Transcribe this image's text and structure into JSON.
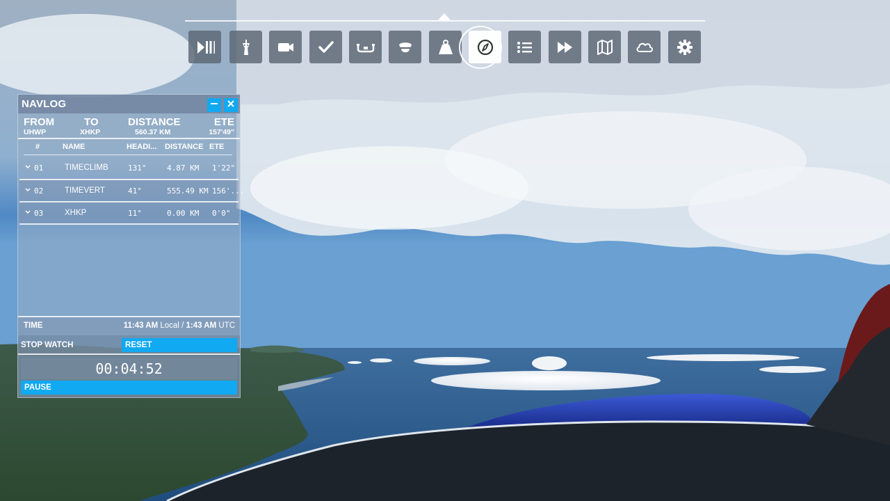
{
  "toolbar": {
    "buttons": [
      {
        "id": "pause-play",
        "icon": "play-pause-icon"
      },
      {
        "id": "atc",
        "icon": "control-tower-icon"
      },
      {
        "id": "camera",
        "icon": "camera-icon"
      },
      {
        "id": "checklist",
        "icon": "checkmark-icon"
      },
      {
        "id": "controls",
        "icon": "yoke-icon"
      },
      {
        "id": "assistance",
        "icon": "pilot-cap-icon"
      },
      {
        "id": "weight-balance",
        "icon": "weight-icon"
      },
      {
        "id": "navlog",
        "icon": "compass-icon",
        "active": true
      },
      {
        "id": "objectives",
        "icon": "list-icon"
      },
      {
        "id": "sim-rate",
        "icon": "fast-forward-icon"
      },
      {
        "id": "vfr-map",
        "icon": "map-icon"
      },
      {
        "id": "weather",
        "icon": "cloud-icon"
      },
      {
        "id": "settings",
        "icon": "gear-icon"
      }
    ]
  },
  "navlog": {
    "title": "NAVLOG",
    "summary": {
      "from_label": "FROM",
      "from_value": "UHWP",
      "to_label": "TO",
      "to_value": "XHKP",
      "distance_label": "DISTANCE",
      "distance_value": "560.37 KM",
      "ete_label": "ETE",
      "ete_value": "157'49\""
    },
    "columns": {
      "num": "#",
      "name": "NAME",
      "heading": "HEADI...",
      "distance": "DISTANCE",
      "ete": "ETE"
    },
    "waypoints": [
      {
        "num": "01",
        "name": "TIMECLIMB",
        "heading": "131°",
        "distance": "4.87 KM",
        "ete": "1'22\""
      },
      {
        "num": "02",
        "name": "TIMEVERT",
        "heading": "41°",
        "distance": "555.49 KM",
        "ete": "156'..."
      },
      {
        "num": "03",
        "name": "XHKP",
        "heading": "11°",
        "distance": "0.00 KM",
        "ete": "0'0\""
      }
    ],
    "time": {
      "label": "TIME",
      "local_value": "11:43 AM",
      "local_suffix": "Local /",
      "utc_value": "1:43 AM",
      "utc_suffix": "UTC"
    },
    "stopwatch": {
      "label": "STOP WATCH",
      "reset_label": "RESET",
      "elapsed": "00:04:52",
      "pause_label": "PAUSE"
    }
  },
  "colors": {
    "accent": "#10a9f2",
    "sky_top": "#a9bed2",
    "sea": "#2d5d8f"
  }
}
